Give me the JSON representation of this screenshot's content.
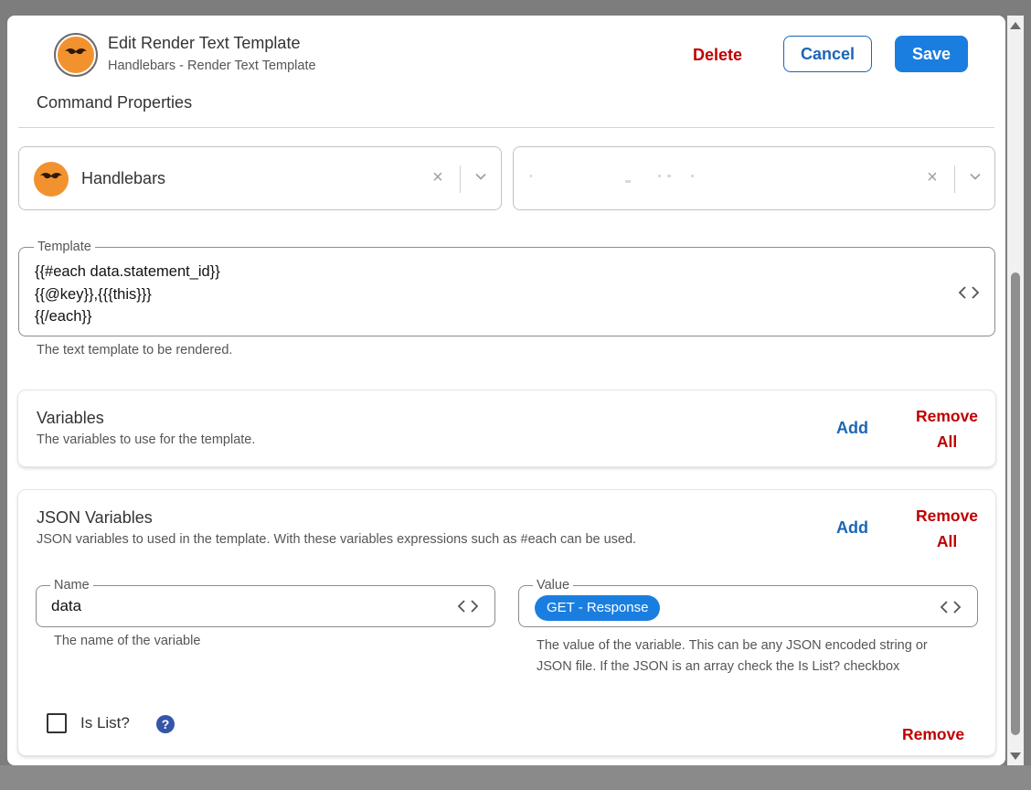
{
  "header": {
    "title": "Edit Render Text Template",
    "subtitle": "Handlebars - Render Text Template",
    "delete_label": "Delete",
    "cancel_label": "Cancel",
    "save_label": "Save",
    "section_title": "Command Properties"
  },
  "connector_select": {
    "value": "Handlebars",
    "clear_glyph": "×"
  },
  "action_select": {
    "clear_glyph": "×"
  },
  "template": {
    "legend": "Template",
    "value": "{{#each data.statement_id}}\n{{@key}},{{{this}}}\n{{/each}}",
    "helper": "The text template to be rendered."
  },
  "variables": {
    "title": "Variables",
    "description": "The variables to use for the template.",
    "add_label": "Add",
    "remove_all_line1": "Remove",
    "remove_all_line2": "All"
  },
  "json_variables": {
    "title": "JSON Variables",
    "description": "JSON variables to used in the template. With these variables expressions such as #each can be used.",
    "add_label": "Add",
    "remove_all_line1": "Remove",
    "remove_all_line2": "All",
    "item": {
      "name_legend": "Name",
      "name_value": "data",
      "name_helper": "The name of the variable",
      "value_legend": "Value",
      "value_chip": "GET - Response",
      "value_helper_line1": "The value of the variable. This can be any JSON encoded string or",
      "value_helper_line2": "JSON file. If the JSON is an array check the Is List? checkbox",
      "is_list_label": "Is List?",
      "is_list_checked": false,
      "help_glyph": "?",
      "remove_label": "Remove"
    }
  },
  "colors": {
    "primary": "#1a7ee0",
    "link_blue": "#1a66b8",
    "danger": "#c00000",
    "brand_orange": "#f2922f"
  }
}
